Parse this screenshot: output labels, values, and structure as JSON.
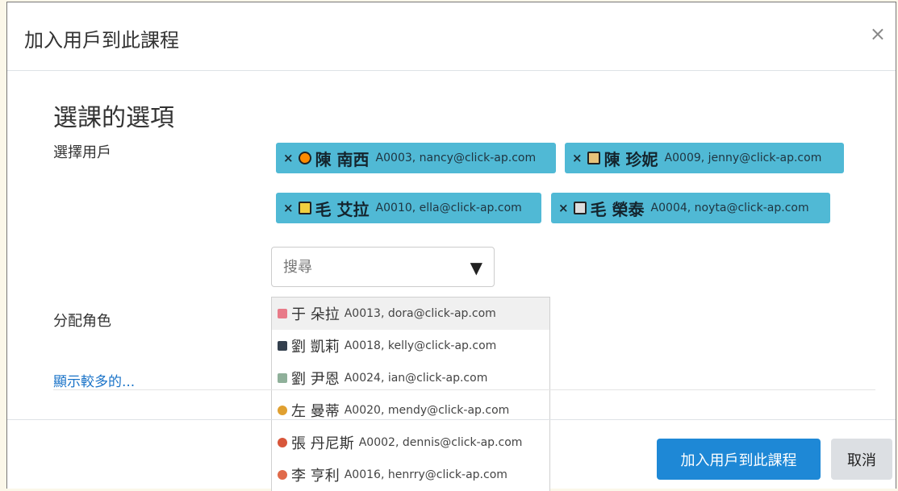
{
  "modal": {
    "title": "加入用戶到此課程",
    "close_label": "×"
  },
  "section": {
    "title": "選課的選項"
  },
  "labels": {
    "select_users": "選擇用戶",
    "assign_role": "分配角色"
  },
  "selected_users": [
    {
      "remove": "×",
      "name": "陳 南西",
      "meta": "A0003, nancy@click-ap.com",
      "avatar": "#ff8a00"
    },
    {
      "remove": "×",
      "name": "陳 珍妮",
      "meta": "A0009, jenny@click-ap.com",
      "avatar": "#e8c37a"
    },
    {
      "remove": "×",
      "name": "毛 艾拉",
      "meta": "A0010, ella@click-ap.com",
      "avatar": "#f0d040"
    },
    {
      "remove": "×",
      "name": "毛 榮泰",
      "meta": "A0004, noyta@click-ap.com",
      "avatar": "#dddddd"
    }
  ],
  "search": {
    "placeholder": "搜尋",
    "arrow": "▼"
  },
  "options": [
    {
      "name": "于 朵拉",
      "meta": "A0013, dora@click-ap.com",
      "avatar": "#e87a88"
    },
    {
      "name": "劉 凱莉",
      "meta": "A0018, kelly@click-ap.com",
      "avatar": "#34404e"
    },
    {
      "name": "劉 尹恩",
      "meta": "A0024, ian@click-ap.com",
      "avatar": "#8fb09a"
    },
    {
      "name": "左 曼蒂",
      "meta": "A0020, mendy@click-ap.com",
      "avatar": "#e0a030"
    },
    {
      "name": "張 丹尼斯",
      "meta": "A0002, dennis@click-ap.com",
      "avatar": "#d8563a"
    },
    {
      "name": "李 亨利",
      "meta": "A0016, henrry@click-ap.com",
      "avatar": "#e06a4a"
    }
  ],
  "show_more": "顯示較多的...",
  "footer": {
    "submit_label": "加入用戶到此課程",
    "cancel_label": "取消"
  }
}
